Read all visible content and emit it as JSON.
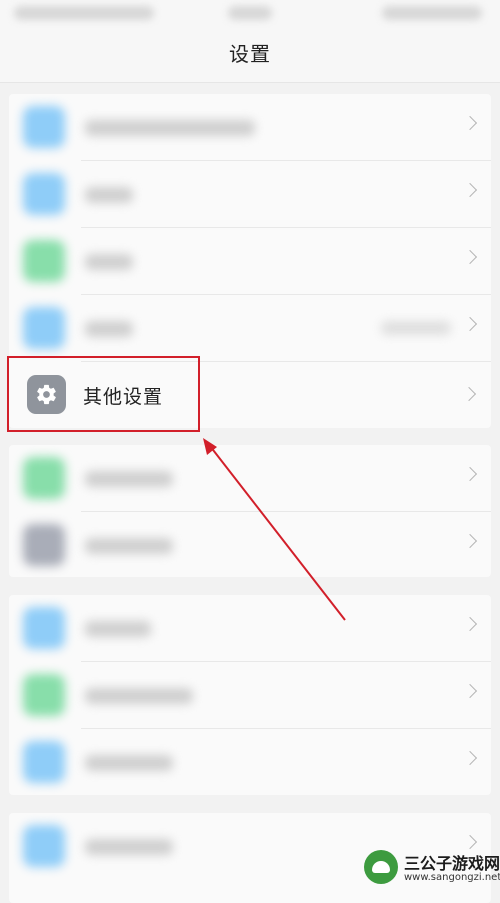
{
  "header": {
    "title": "设置"
  },
  "target_item": {
    "label": "其他设置",
    "icon": "gear-icon",
    "icon_bg": "#8f949c"
  },
  "annotation": {
    "color": "#d21f2a"
  },
  "watermark": {
    "title": "三公子游戏网",
    "url": "www.sangongzi.net"
  },
  "blurred_rows": [
    {
      "icon_color": "#8fcdf8"
    },
    {
      "icon_color": "#8fcdf8"
    },
    {
      "icon_color": "#88deaa"
    },
    {
      "icon_color": "#8fcdf8"
    },
    {
      "icon_color": "#88deaa"
    },
    {
      "icon_color": "#a9adb8"
    },
    {
      "icon_color": "#8fcdf8"
    },
    {
      "icon_color": "#88deaa"
    },
    {
      "icon_color": "#8fcdf8"
    },
    {
      "icon_color": "#8fcdf8"
    }
  ]
}
